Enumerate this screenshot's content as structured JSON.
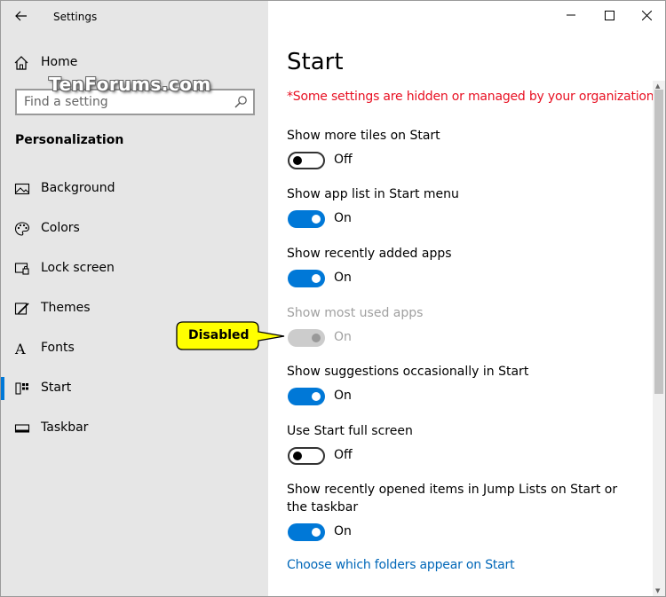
{
  "window": {
    "title": "Settings"
  },
  "sidebar": {
    "home_label": "Home",
    "search_placeholder": "Find a setting",
    "section_label": "Personalization",
    "items": [
      {
        "label": "Background",
        "icon": "picture-icon",
        "active": false
      },
      {
        "label": "Colors",
        "icon": "palette-icon",
        "active": false
      },
      {
        "label": "Lock screen",
        "icon": "lock-screen-icon",
        "active": false
      },
      {
        "label": "Themes",
        "icon": "brush-icon",
        "active": false
      },
      {
        "label": "Fonts",
        "icon": "font-icon",
        "active": false
      },
      {
        "label": "Start",
        "icon": "start-icon",
        "active": true
      },
      {
        "label": "Taskbar",
        "icon": "taskbar-icon",
        "active": false
      }
    ]
  },
  "watermark": "TenForums.com",
  "main": {
    "title": "Start",
    "warning": "*Some settings are hidden or managed by your organization.",
    "settings": [
      {
        "label": "Show more tiles on Start",
        "state": "Off",
        "on": false,
        "disabled": false
      },
      {
        "label": "Show app list in Start menu",
        "state": "On",
        "on": true,
        "disabled": false
      },
      {
        "label": "Show recently added apps",
        "state": "On",
        "on": true,
        "disabled": false
      },
      {
        "label": "Show most used apps",
        "state": "On",
        "on": true,
        "disabled": true
      },
      {
        "label": "Show suggestions occasionally in Start",
        "state": "On",
        "on": true,
        "disabled": false
      },
      {
        "label": "Use Start full screen",
        "state": "Off",
        "on": false,
        "disabled": false
      },
      {
        "label": "Show recently opened items in Jump Lists on Start or the taskbar",
        "state": "On",
        "on": true,
        "disabled": false
      }
    ],
    "link": "Choose which folders appear on Start"
  },
  "callout": {
    "text": "Disabled"
  },
  "colors": {
    "accent": "#0078d7",
    "warning": "#e81123",
    "link": "#0067b8",
    "sidebar_bg": "#e6e6e6",
    "callout_bg": "#ffff00"
  }
}
